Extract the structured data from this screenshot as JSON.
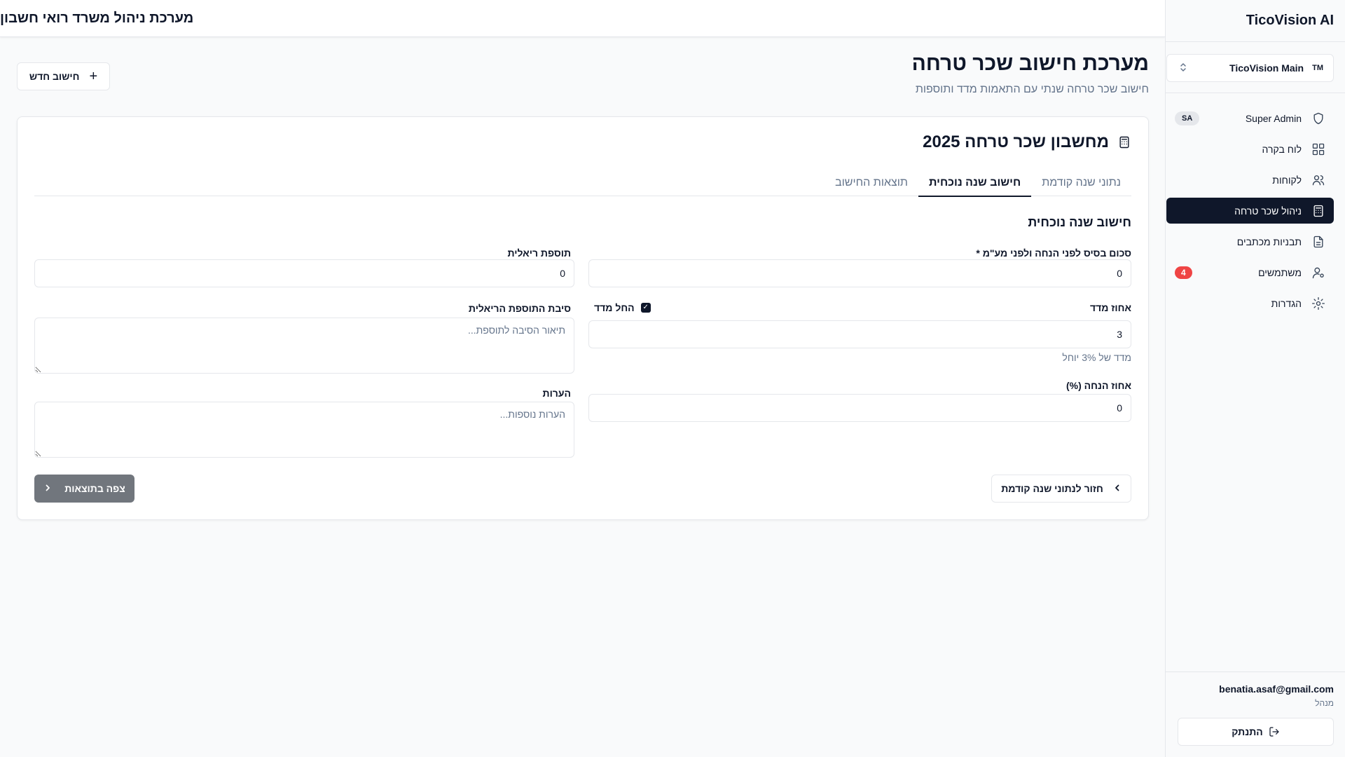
{
  "app": {
    "brand": "TicoVision AI",
    "header_title": "מערכת ניהול משרד רואי חשבון"
  },
  "workspace": {
    "abbr": "TM",
    "name": "TicoVision Main"
  },
  "sidebar": {
    "items": [
      {
        "label": "Super Admin",
        "icon": "shield-icon",
        "badge": "SA",
        "active": false
      },
      {
        "label": "לוח בקרה",
        "icon": "dashboard-icon",
        "active": false
      },
      {
        "label": "לקוחות",
        "icon": "users-icon",
        "active": false
      },
      {
        "label": "ניהול שכר טרחה",
        "icon": "calculator-icon",
        "active": true
      },
      {
        "label": "תבניות מכתבים",
        "icon": "file-text-icon",
        "active": false
      },
      {
        "label": "משתמשים",
        "icon": "user-cog-icon",
        "badge": "4",
        "active": false
      },
      {
        "label": "הגדרות",
        "icon": "gear-icon",
        "active": false
      }
    ],
    "user_email": "benatia.asaf@gmail.com",
    "user_role": "מנהל",
    "logout_label": "התנתק"
  },
  "page": {
    "title": "מערכת חישוב שכר טרחה",
    "subtitle": "חישוב שכר טרחה שנתי עם התאמות מדד ותוספות",
    "new_button_label": "חישוב חדש"
  },
  "card": {
    "title": "מחשבון שכר טרחה 2025",
    "tabs": [
      {
        "label": "נתוני שנה קודמת",
        "active": false
      },
      {
        "label": "חישוב שנה נוכחית",
        "active": true
      },
      {
        "label": "תוצאות החישוב",
        "active": false
      }
    ],
    "section_title": "חישוב שנה נוכחית",
    "fields": {
      "base_amount_label": "סכום בסיס לפני הנחה ולפני מע\"מ *",
      "base_amount_value": "0",
      "real_addition_label": "תוספת ריאלית",
      "real_addition_value": "0",
      "index_percent_label": "אחוז מדד",
      "index_percent_value": "3",
      "apply_index_label": "החל מדד",
      "apply_index_checked": true,
      "index_hint": "מדד של 3% יוחל",
      "reason_label": "סיבת התוספת הריאלית",
      "reason_placeholder": "תיאור הסיבה לתוספת...",
      "discount_label": "אחוז הנחה (%)",
      "discount_value": "0",
      "notes_label": "הערות",
      "notes_placeholder": "הערות נוספות..."
    },
    "back_button_label": "חזור לנתוני שנה קודמת",
    "results_button_label": "צפה בתוצאות"
  },
  "colors": {
    "primary": "#0f172a",
    "muted": "#64748b",
    "border": "#e5e7eb",
    "danger": "#ef4444",
    "disabled_button": "#71767d"
  }
}
